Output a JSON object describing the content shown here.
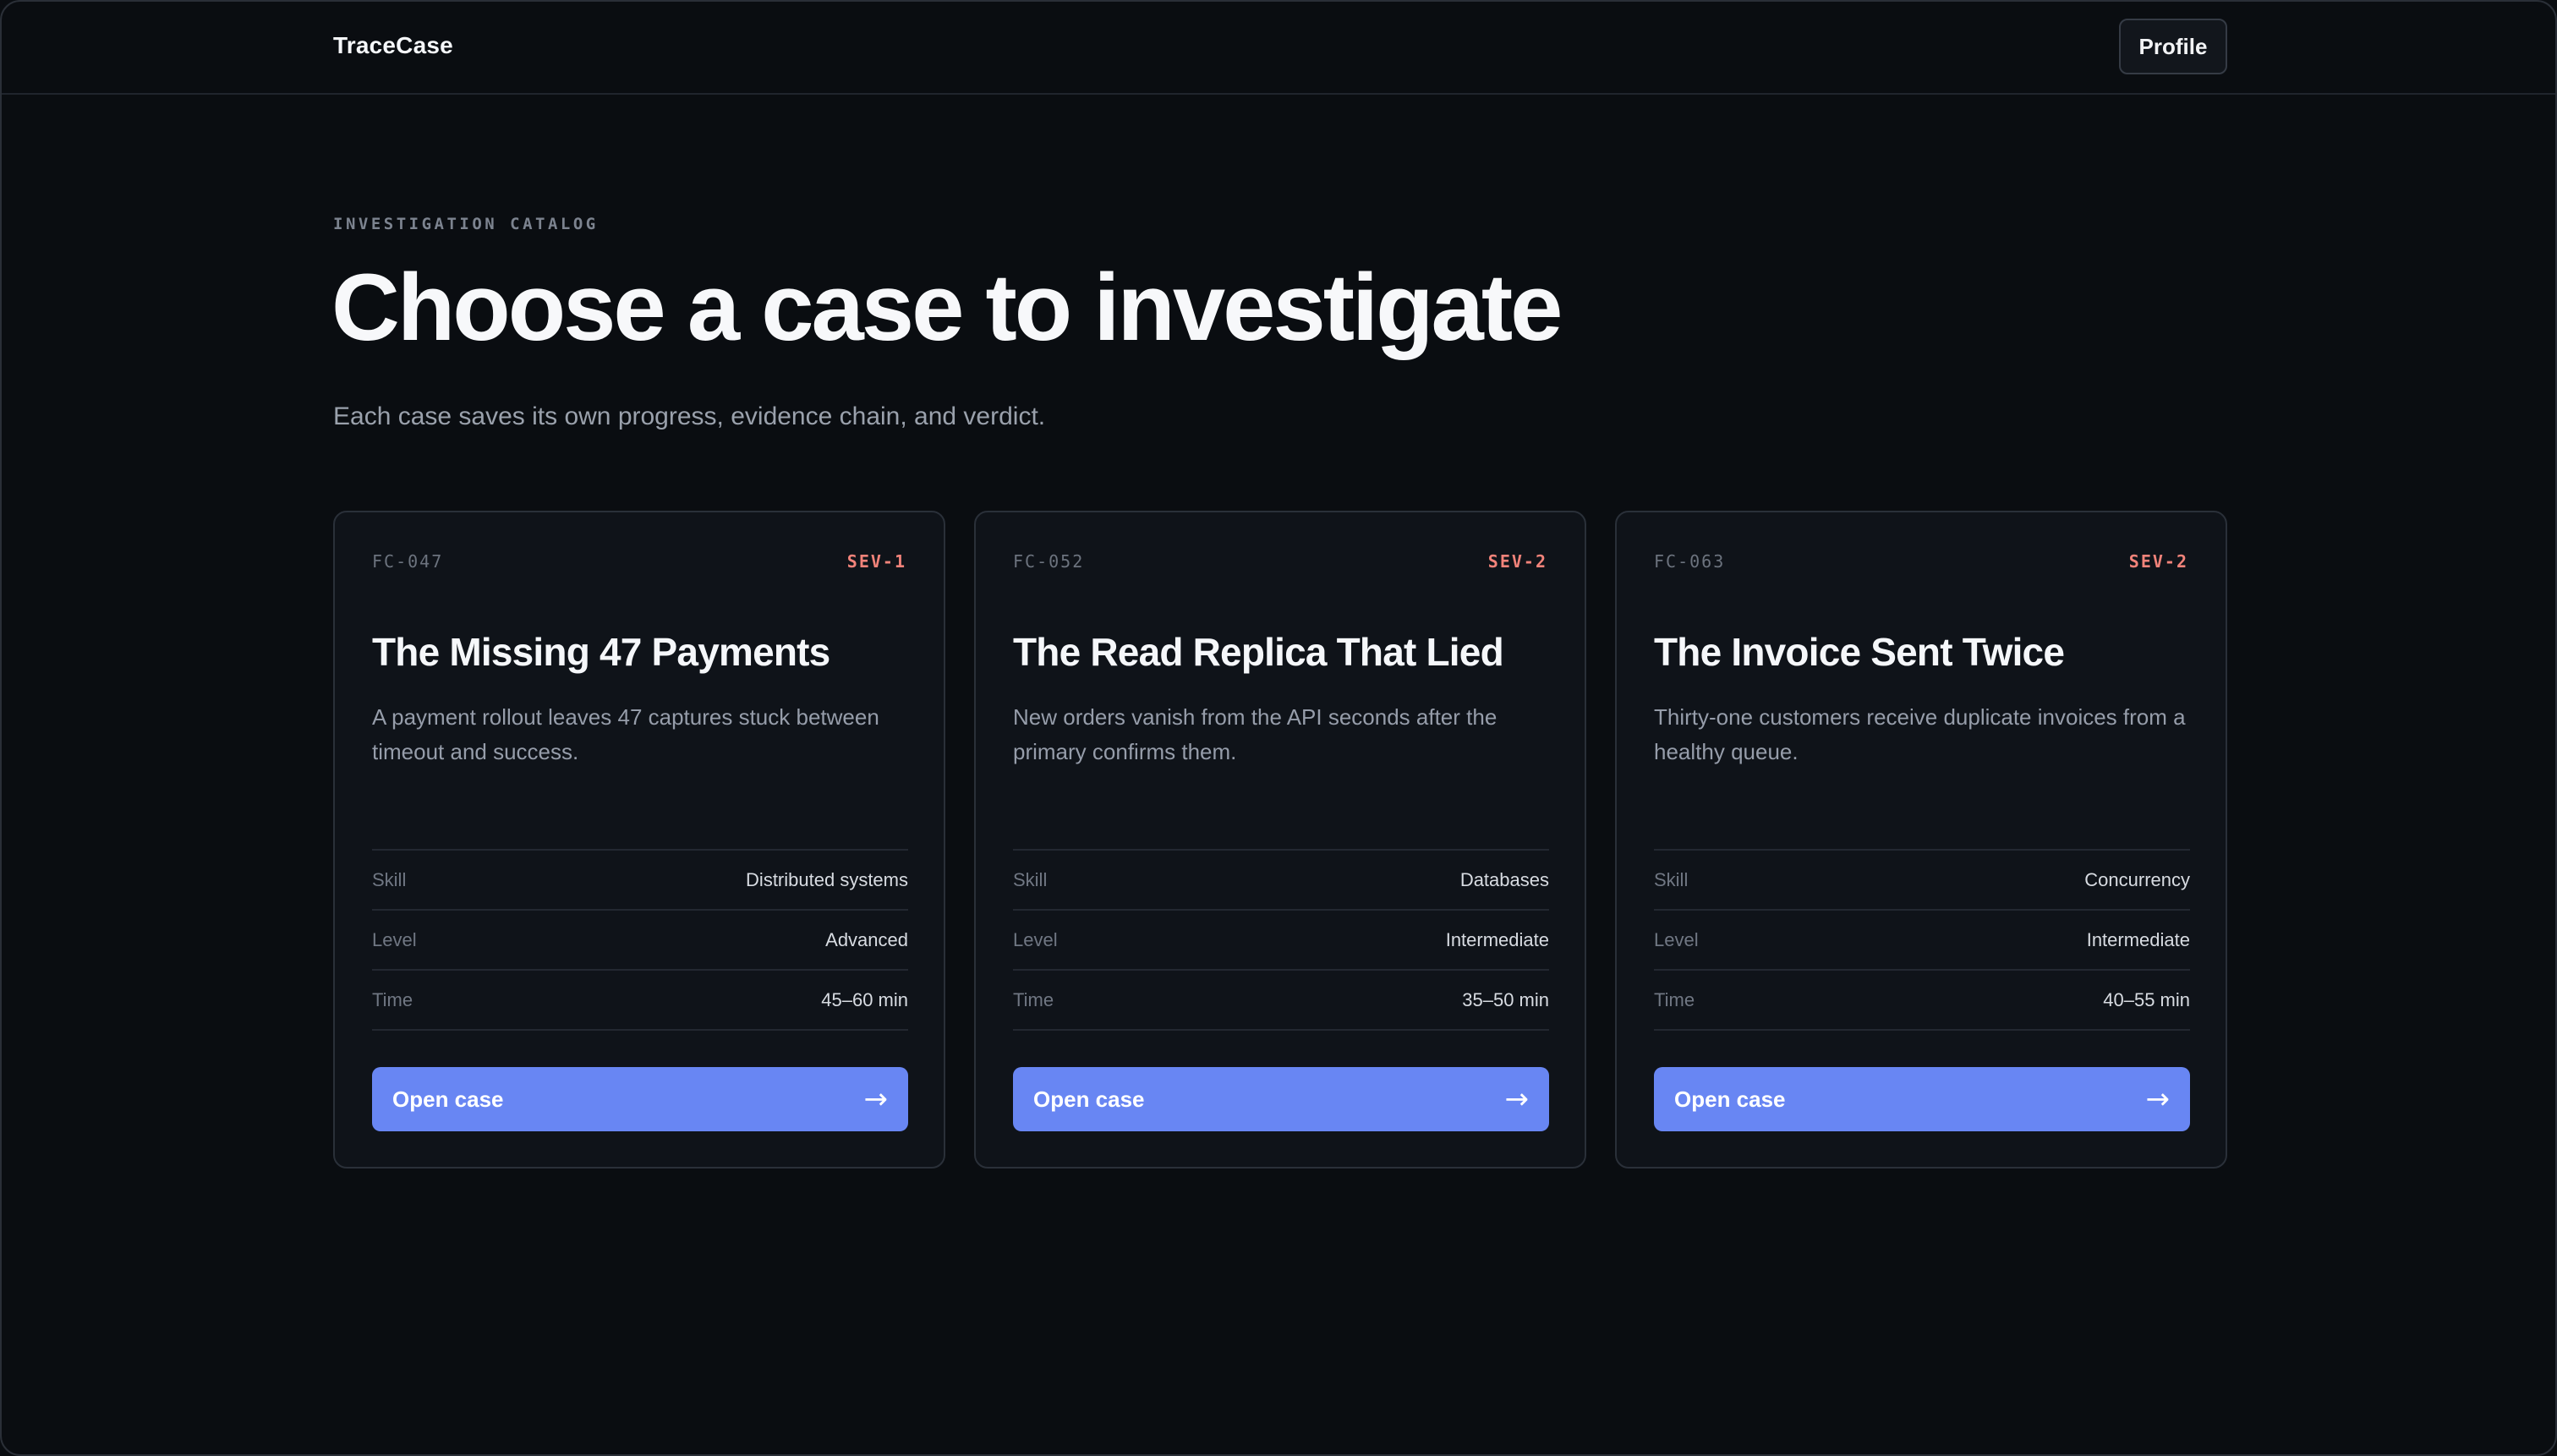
{
  "app": {
    "brand": "TraceCase",
    "profile_label": "Profile"
  },
  "hero": {
    "eyebrow": "INVESTIGATION CATALOG",
    "title": "Choose a case to investigate",
    "subtitle": "Each case saves its own progress, evidence chain, and verdict."
  },
  "cards": [
    {
      "id": "FC-047",
      "severity": "SEV-1",
      "title": "The Missing 47 Payments",
      "description": "A payment rollout leaves 47 captures stuck between timeout and success.",
      "meta": [
        {
          "key": "Skill",
          "value": "Distributed systems"
        },
        {
          "key": "Level",
          "value": "Advanced"
        },
        {
          "key": "Time",
          "value": "45–60 min"
        }
      ],
      "button_label": "Open case",
      "button_icon": "→"
    },
    {
      "id": "FC-052",
      "severity": "SEV-2",
      "title": "The Read Replica That Lied",
      "description": "New orders vanish from the API seconds after the primary confirms them.",
      "meta": [
        {
          "key": "Skill",
          "value": "Databases"
        },
        {
          "key": "Level",
          "value": "Intermediate"
        },
        {
          "key": "Time",
          "value": "35–50 min"
        }
      ],
      "button_label": "Open case",
      "button_icon": "→"
    },
    {
      "id": "FC-063",
      "severity": "SEV-2",
      "title": "The Invoice Sent Twice",
      "description": "Thirty-one customers receive duplicate invoices from a healthy queue.",
      "meta": [
        {
          "key": "Skill",
          "value": "Concurrency"
        },
        {
          "key": "Level",
          "value": "Intermediate"
        },
        {
          "key": "Time",
          "value": "40–55 min"
        }
      ],
      "button_label": "Open case",
      "button_icon": "→"
    }
  ],
  "colors": {
    "background": "#0a0d11",
    "card_background": "#0f1319",
    "accent": "#6886f3",
    "severity": "#f2837a"
  }
}
